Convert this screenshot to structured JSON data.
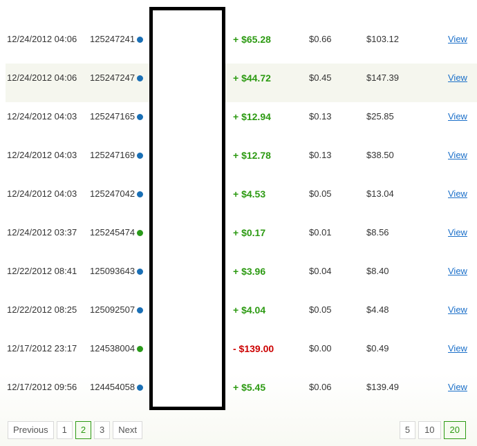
{
  "colors": {
    "positive": "#2c9a12",
    "negative": "#cc0000",
    "dot_blue": "#1a6fb5",
    "dot_green": "#2a9a1a",
    "link": "#1a6fc9"
  },
  "rows": [
    {
      "date": "12/24/2012 04:06",
      "id": "125247241",
      "dot": "blue",
      "amount": "+ $65.28",
      "sign": "positive",
      "fee": "$0.66",
      "balance": "$103.12",
      "action": "View"
    },
    {
      "date": "12/24/2012 04:06",
      "id": "125247247",
      "dot": "blue",
      "amount": "+ $44.72",
      "sign": "positive",
      "fee": "$0.45",
      "balance": "$147.39",
      "action": "View"
    },
    {
      "date": "12/24/2012 04:03",
      "id": "125247165",
      "dot": "blue",
      "amount": "+ $12.94",
      "sign": "positive",
      "fee": "$0.13",
      "balance": "$25.85",
      "action": "View"
    },
    {
      "date": "12/24/2012 04:03",
      "id": "125247169",
      "dot": "blue",
      "amount": "+ $12.78",
      "sign": "positive",
      "fee": "$0.13",
      "balance": "$38.50",
      "action": "View"
    },
    {
      "date": "12/24/2012 04:03",
      "id": "125247042",
      "dot": "blue",
      "amount": "+ $4.53",
      "sign": "positive",
      "fee": "$0.05",
      "balance": "$13.04",
      "action": "View"
    },
    {
      "date": "12/24/2012 03:37",
      "id": "125245474",
      "dot": "green",
      "amount": "+ $0.17",
      "sign": "positive",
      "fee": "$0.01",
      "balance": "$8.56",
      "action": "View"
    },
    {
      "date": "12/22/2012 08:41",
      "id": "125093643",
      "dot": "blue",
      "amount": "+ $3.96",
      "sign": "positive",
      "fee": "$0.04",
      "balance": "$8.40",
      "action": "View"
    },
    {
      "date": "12/22/2012 08:25",
      "id": "125092507",
      "dot": "blue",
      "amount": "+ $4.04",
      "sign": "positive",
      "fee": "$0.05",
      "balance": "$4.48",
      "action": "View"
    },
    {
      "date": "12/17/2012 23:17",
      "id": "124538004",
      "dot": "green",
      "amount": "- $139.00",
      "sign": "negative",
      "fee": "$0.00",
      "balance": "$0.49",
      "action": "View"
    },
    {
      "date": "12/17/2012 09:56",
      "id": "124454058",
      "dot": "blue",
      "amount": "+ $5.45",
      "sign": "positive",
      "fee": "$0.06",
      "balance": "$139.49",
      "action": "View"
    }
  ],
  "pagination": {
    "previous": "Previous",
    "pages": [
      "1",
      "2",
      "3"
    ],
    "current": "2",
    "next": "Next"
  },
  "page_size": {
    "options": [
      "5",
      "10",
      "20"
    ],
    "current": "20"
  }
}
